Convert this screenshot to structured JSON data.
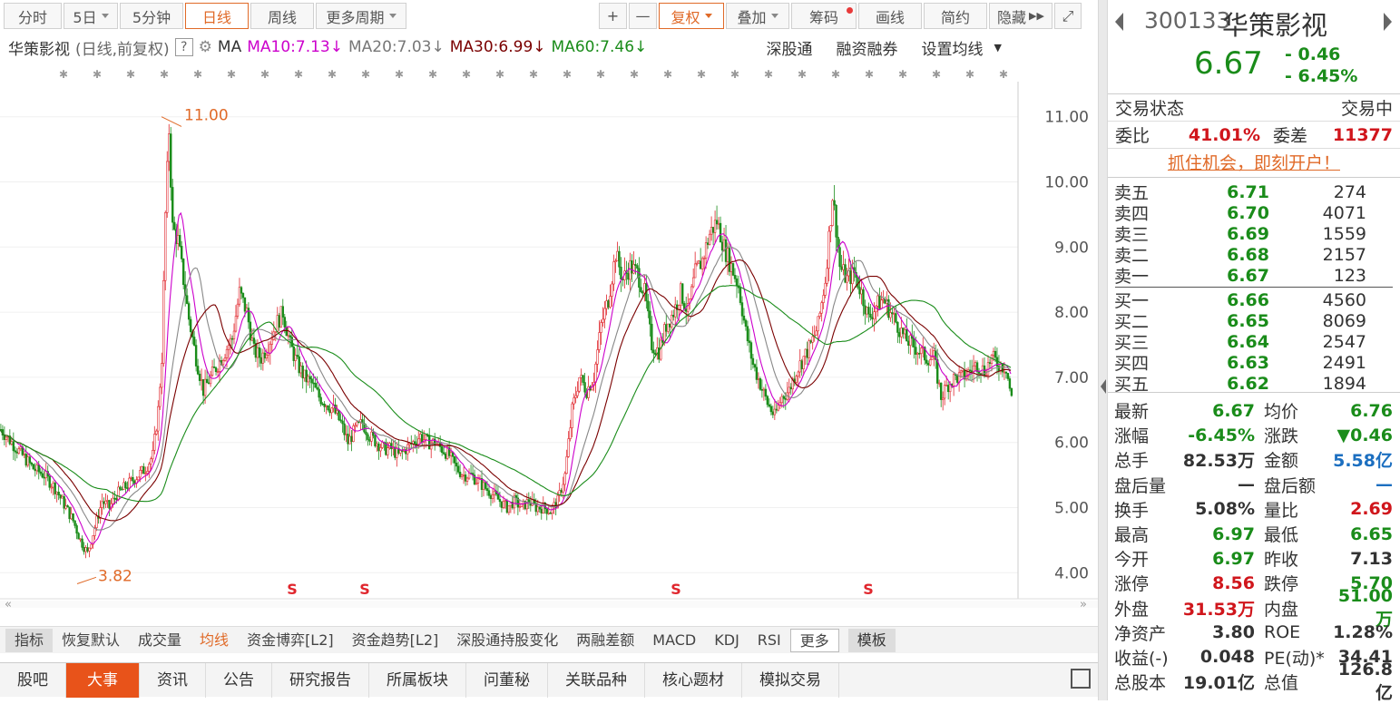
{
  "toolbar": {
    "periods": [
      "分时",
      "5日",
      "5分钟",
      "日线",
      "周线",
      "更多周期"
    ],
    "active_period": "日线",
    "zoom_in": "+",
    "zoom_out": "—",
    "fuquan": "复权",
    "overlay": "叠加",
    "chouma": "筹码",
    "draw": "画线",
    "simple": "简约",
    "hide": "隐藏"
  },
  "ma_line": {
    "stock": "华策影视",
    "mode": "(日线,前复权)",
    "help": "?",
    "ma_label": "MA",
    "ma10": "MA10:7.13",
    "ma20": "MA20:7.03",
    "ma30": "MA30:6.99",
    "ma60": "MA60:7.46",
    "links": [
      "深股通",
      "融资融券",
      "设置均线"
    ]
  },
  "chart_data": {
    "type": "candlestick",
    "ylim": [
      3.6,
      11.4
    ],
    "y_ticks": [
      4.0,
      5.0,
      6.0,
      7.0,
      8.0,
      9.0,
      10.0,
      11.0
    ],
    "y_tick_labels": [
      "4.00",
      "5.00",
      "6.00",
      "7.00",
      "8.00",
      "9.00",
      "10.00",
      "11.00"
    ],
    "max_label": "11.00",
    "min_label": "3.82",
    "close_path": [
      [
        0,
        6.2
      ],
      [
        6,
        6.0
      ],
      [
        12,
        5.8
      ],
      [
        18,
        5.6
      ],
      [
        24,
        5.5
      ],
      [
        30,
        5.3
      ],
      [
        36,
        5.0
      ],
      [
        40,
        4.8
      ],
      [
        44,
        4.5
      ],
      [
        48,
        4.3
      ],
      [
        52,
        4.7
      ],
      [
        56,
        5.1
      ],
      [
        60,
        5.0
      ],
      [
        64,
        5.2
      ],
      [
        68,
        5.3
      ],
      [
        72,
        5.4
      ],
      [
        76,
        5.5
      ],
      [
        80,
        5.6
      ],
      [
        84,
        5.8
      ],
      [
        87,
        6.5
      ],
      [
        89,
        7.3
      ],
      [
        91,
        9.5
      ],
      [
        93,
        10.8
      ],
      [
        95,
        9.3
      ],
      [
        98,
        9.1
      ],
      [
        101,
        8.5
      ],
      [
        104,
        7.9
      ],
      [
        108,
        7.3
      ],
      [
        112,
        6.8
      ],
      [
        116,
        7.0
      ],
      [
        120,
        7.2
      ],
      [
        124,
        7.4
      ],
      [
        128,
        7.6
      ],
      [
        132,
        8.3
      ],
      [
        136,
        8.0
      ],
      [
        140,
        7.4
      ],
      [
        144,
        7.3
      ],
      [
        148,
        7.5
      ],
      [
        152,
        7.8
      ],
      [
        156,
        8.0
      ],
      [
        160,
        7.5
      ],
      [
        164,
        7.2
      ],
      [
        168,
        7.0
      ],
      [
        172,
        6.9
      ],
      [
        176,
        6.7
      ],
      [
        180,
        6.6
      ],
      [
        184,
        6.5
      ],
      [
        188,
        6.3
      ],
      [
        192,
        6.0
      ],
      [
        196,
        6.2
      ],
      [
        200,
        6.3
      ],
      [
        204,
        6.1
      ],
      [
        208,
        6.0
      ],
      [
        212,
        5.9
      ],
      [
        216,
        5.9
      ],
      [
        220,
        5.8
      ],
      [
        224,
        5.9
      ],
      [
        228,
        6.0
      ],
      [
        232,
        6.1
      ],
      [
        236,
        6.0
      ],
      [
        240,
        6.0
      ],
      [
        244,
        5.9
      ],
      [
        248,
        5.8
      ],
      [
        252,
        5.6
      ],
      [
        256,
        5.5
      ],
      [
        260,
        5.5
      ],
      [
        264,
        5.4
      ],
      [
        268,
        5.3
      ],
      [
        272,
        5.2
      ],
      [
        276,
        5.1
      ],
      [
        280,
        5.0
      ],
      [
        284,
        5.1
      ],
      [
        288,
        5.0
      ],
      [
        292,
        5.1
      ],
      [
        296,
        5.0
      ],
      [
        300,
        5.0
      ],
      [
        304,
        4.95
      ],
      [
        308,
        5.1
      ],
      [
        312,
        5.5
      ],
      [
        316,
        6.5
      ],
      [
        320,
        7.0
      ],
      [
        324,
        6.8
      ],
      [
        328,
        7.0
      ],
      [
        332,
        7.8
      ],
      [
        336,
        8.2
      ],
      [
        340,
        8.9
      ],
      [
        344,
        8.5
      ],
      [
        348,
        8.7
      ],
      [
        352,
        8.6
      ],
      [
        356,
        8.3
      ],
      [
        360,
        7.5
      ],
      [
        364,
        7.4
      ],
      [
        368,
        7.8
      ],
      [
        372,
        8.0
      ],
      [
        376,
        8.3
      ],
      [
        380,
        8.0
      ],
      [
        384,
        8.6
      ],
      [
        388,
        8.8
      ],
      [
        392,
        9.2
      ],
      [
        396,
        9.4
      ],
      [
        400,
        9.0
      ],
      [
        404,
        8.7
      ],
      [
        408,
        8.4
      ],
      [
        412,
        7.7
      ],
      [
        416,
        7.2
      ],
      [
        420,
        6.9
      ],
      [
        424,
        6.6
      ],
      [
        428,
        6.4
      ],
      [
        432,
        6.7
      ],
      [
        436,
        6.8
      ],
      [
        440,
        7.1
      ],
      [
        444,
        7.3
      ],
      [
        448,
        7.5
      ],
      [
        452,
        7.8
      ],
      [
        456,
        8.5
      ],
      [
        460,
        9.8
      ],
      [
        462,
        9.3
      ],
      [
        464,
        8.7
      ],
      [
        468,
        8.5
      ],
      [
        472,
        8.6
      ],
      [
        476,
        8.3
      ],
      [
        480,
        7.9
      ],
      [
        484,
        8.1
      ],
      [
        488,
        8.2
      ],
      [
        492,
        8.0
      ],
      [
        496,
        7.8
      ],
      [
        500,
        7.6
      ],
      [
        504,
        7.5
      ],
      [
        508,
        7.4
      ],
      [
        512,
        7.3
      ],
      [
        516,
        7.3
      ],
      [
        520,
        6.7
      ],
      [
        524,
        6.9
      ],
      [
        528,
        7.0
      ],
      [
        532,
        7.0
      ],
      [
        536,
        7.1
      ],
      [
        540,
        7.2
      ],
      [
        544,
        7.1
      ],
      [
        548,
        7.3
      ],
      [
        552,
        7.2
      ],
      [
        556,
        7.15
      ],
      [
        559,
        6.67
      ]
    ]
  },
  "indicator_tabs": [
    "指标",
    "恢复默认",
    "成交量",
    "均线",
    "资金博弈[L2]",
    "资金趋势[L2]",
    "深股通持股变化",
    "两融差额",
    "MACD",
    "KDJ",
    "RSI",
    "更多",
    "模板"
  ],
  "bottom_tabs": [
    "股吧",
    "大事",
    "资讯",
    "公告",
    "研究报告",
    "所属板块",
    "问董秘",
    "关联品种",
    "核心题材",
    "模拟交易"
  ],
  "active_bottom_tab": "大事",
  "quote": {
    "code": "300133",
    "name": "华策影视",
    "price": "6.67",
    "change": "- 0.46",
    "change_pct": "- 6.45%",
    "status_label": "交易状态",
    "status_value": "交易中",
    "weibi_label": "委比",
    "weibi_value": "41.01%",
    "weicha_label": "委差",
    "weicha_value": "11377",
    "promo": "抓住机会，即刻开户！"
  },
  "order_book": {
    "asks": [
      {
        "label": "卖五",
        "price": "6.71",
        "vol": "274"
      },
      {
        "label": "卖四",
        "price": "6.70",
        "vol": "4071"
      },
      {
        "label": "卖三",
        "price": "6.69",
        "vol": "1559"
      },
      {
        "label": "卖二",
        "price": "6.68",
        "vol": "2157"
      },
      {
        "label": "卖一",
        "price": "6.67",
        "vol": "123"
      }
    ],
    "bids": [
      {
        "label": "买一",
        "price": "6.66",
        "vol": "4560"
      },
      {
        "label": "买二",
        "price": "6.65",
        "vol": "8069"
      },
      {
        "label": "买三",
        "price": "6.64",
        "vol": "2547"
      },
      {
        "label": "买四",
        "price": "6.63",
        "vol": "2491"
      },
      {
        "label": "买五",
        "price": "6.62",
        "vol": "1894"
      }
    ]
  },
  "stats": [
    {
      "a": "最新",
      "av": "6.67",
      "ac": "green",
      "b": "均价",
      "bv": "6.76",
      "bc": "green"
    },
    {
      "a": "涨幅",
      "av": "-6.45%",
      "ac": "green",
      "b": "涨跌",
      "bv": "▼0.46",
      "bc": "green"
    },
    {
      "a": "总手",
      "av": "82.53万",
      "ac": "dark",
      "b": "金额",
      "bv": "5.58亿",
      "bc": "blue"
    },
    {
      "a": "盘后量",
      "av": "—",
      "ac": "dark",
      "b": "盘后额",
      "bv": "—",
      "bc": "blue"
    },
    {
      "a": "换手",
      "av": "5.08%",
      "ac": "dark",
      "b": "量比",
      "bv": "2.69",
      "bc": "red"
    },
    {
      "a": "最高",
      "av": "6.97",
      "ac": "green",
      "b": "最低",
      "bv": "6.65",
      "bc": "green"
    },
    {
      "a": "今开",
      "av": "6.97",
      "ac": "green",
      "b": "昨收",
      "bv": "7.13",
      "bc": "dark"
    },
    {
      "a": "涨停",
      "av": "8.56",
      "ac": "red",
      "b": "跌停",
      "bv": "5.70",
      "bc": "green"
    },
    {
      "a": "外盘",
      "av": "31.53万",
      "ac": "red",
      "b": "内盘",
      "bv": "51.00万",
      "bc": "green"
    },
    {
      "a": "净资产",
      "av": "3.80",
      "ac": "dark",
      "b": "ROE",
      "bv": "1.28%",
      "bc": "dark"
    },
    {
      "a": "收益(-)",
      "av": "0.048",
      "ac": "dark",
      "b": "PE(动)*",
      "bv": "34.41",
      "bc": "dark"
    },
    {
      "a": "总股本",
      "av": "19.01亿",
      "ac": "dark",
      "b": "总值",
      "bv": "126.8亿",
      "bc": "dark"
    }
  ],
  "colors": {
    "up": "#e0262d",
    "down": "#1a8c1a",
    "ma10": "#cc00cc",
    "ma20": "#888888",
    "ma30": "#7a0000",
    "ma60": "#1a8c1a",
    "accent": "#e06a28"
  }
}
